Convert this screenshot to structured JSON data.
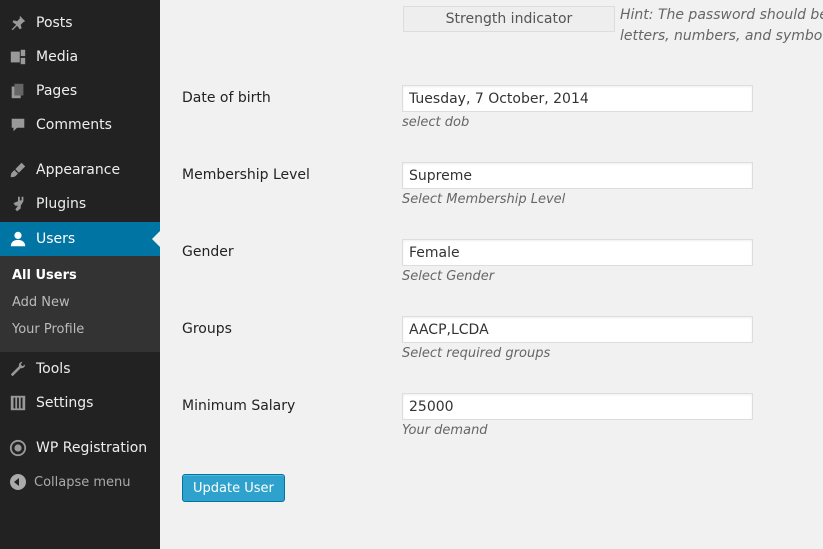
{
  "sidebar": {
    "items": [
      {
        "label": "Posts",
        "icon": "pushpin-icon"
      },
      {
        "label": "Media",
        "icon": "media-icon"
      },
      {
        "label": "Pages",
        "icon": "pages-icon"
      },
      {
        "label": "Comments",
        "icon": "comment-icon"
      },
      {
        "label": "Appearance",
        "icon": "paintbrush-icon"
      },
      {
        "label": "Plugins",
        "icon": "plugin-icon"
      },
      {
        "label": "Users",
        "icon": "user-icon"
      },
      {
        "label": "Tools",
        "icon": "wrench-icon"
      },
      {
        "label": "Settings",
        "icon": "settings-icon"
      },
      {
        "label": "WP Registration",
        "icon": "wordpress-icon"
      }
    ],
    "submenu": [
      "All Users",
      "Add New",
      "Your Profile"
    ],
    "collapse_label": "Collapse menu",
    "active_color": "#0074a2"
  },
  "password": {
    "strength_label": "Strength indicator",
    "hint_line1": "Hint: The password should be at l",
    "hint_line2": "letters, numbers, and symbols lik"
  },
  "fields": [
    {
      "label": "Date of birth",
      "value": "Tuesday, 7 October, 2014",
      "desc": "select dob"
    },
    {
      "label": "Membership Level",
      "value": "Supreme",
      "desc": "Select Membership Level"
    },
    {
      "label": "Gender",
      "value": "Female",
      "desc": "Select Gender"
    },
    {
      "label": "Groups",
      "value": "AACP,LCDA",
      "desc": "Select required groups"
    },
    {
      "label": "Minimum Salary",
      "value": "25000",
      "desc": "Your demand"
    }
  ],
  "update_button": "Update User",
  "button_color": "#2ea2cc"
}
